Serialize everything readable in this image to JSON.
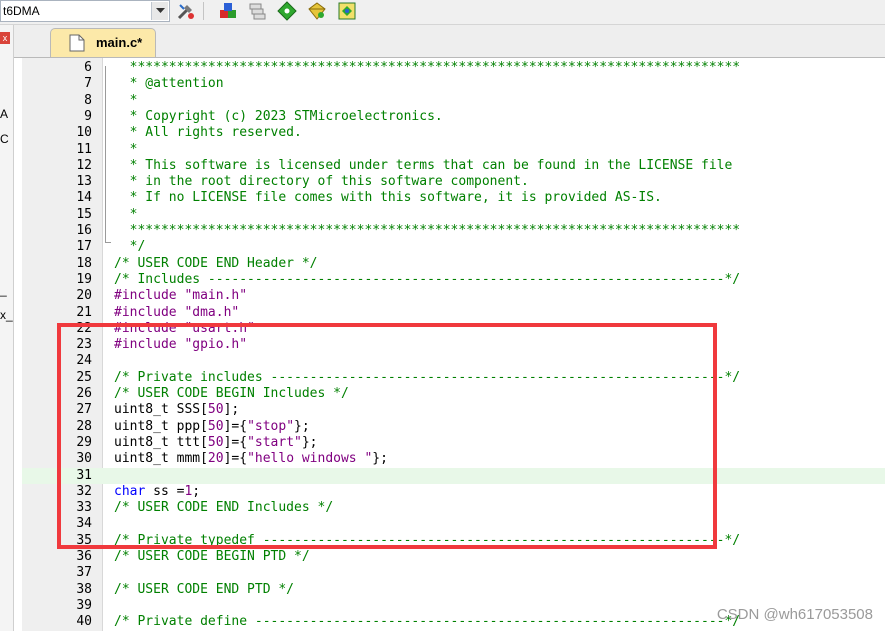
{
  "toolbar": {
    "target_name": "t6DMA",
    "icons": [
      "options-for-target-icon",
      "manage-components-icon",
      "file-extensions-icon",
      "select-packs-icon",
      "pack-installer-icon",
      "run-time-environment-icon"
    ]
  },
  "side_panel": {
    "close_glyph": "x",
    "fragments": [
      "A",
      "C",
      "_",
      "x_"
    ]
  },
  "tabs": [
    {
      "label": "main.c*",
      "active": true
    }
  ],
  "editor": {
    "lines": [
      {
        "n": "6",
        "t": [
          [
            "c-cmt",
            "  ******************************************************************************"
          ]
        ]
      },
      {
        "n": "7",
        "t": [
          [
            "c-cmt",
            "  * @attention"
          ]
        ]
      },
      {
        "n": "8",
        "t": [
          [
            "c-cmt",
            "  *"
          ]
        ]
      },
      {
        "n": "9",
        "t": [
          [
            "c-cmt",
            "  * Copyright (c) 2023 STMicroelectronics."
          ]
        ]
      },
      {
        "n": "10",
        "t": [
          [
            "c-cmt",
            "  * All rights reserved."
          ]
        ]
      },
      {
        "n": "11",
        "t": [
          [
            "c-cmt",
            "  *"
          ]
        ]
      },
      {
        "n": "12",
        "t": [
          [
            "c-cmt",
            "  * This software is licensed under terms that can be found in the LICENSE file"
          ]
        ]
      },
      {
        "n": "13",
        "t": [
          [
            "c-cmt",
            "  * in the root directory of this software component."
          ]
        ]
      },
      {
        "n": "14",
        "t": [
          [
            "c-cmt",
            "  * If no LICENSE file comes with this software, it is provided AS-IS."
          ]
        ]
      },
      {
        "n": "15",
        "t": [
          [
            "c-cmt",
            "  *"
          ]
        ]
      },
      {
        "n": "16",
        "t": [
          [
            "c-cmt",
            "  ******************************************************************************"
          ]
        ]
      },
      {
        "n": "17",
        "t": [
          [
            "c-cmt",
            "  */"
          ]
        ]
      },
      {
        "n": "18",
        "t": [
          [
            "c-cmt",
            "/* USER CODE END Header */"
          ]
        ]
      },
      {
        "n": "19",
        "t": [
          [
            "c-cmt",
            "/* Includes ------------------------------------------------------------------*/"
          ]
        ]
      },
      {
        "n": "20",
        "t": [
          [
            "c-pp",
            "#include "
          ],
          [
            "c-str",
            "\"main.h\""
          ]
        ]
      },
      {
        "n": "21",
        "t": [
          [
            "c-pp",
            "#include "
          ],
          [
            "c-str",
            "\"dma.h\""
          ]
        ]
      },
      {
        "n": "22",
        "t": [
          [
            "c-pp",
            "#include "
          ],
          [
            "c-str",
            "\"usart.h\""
          ]
        ]
      },
      {
        "n": "23",
        "t": [
          [
            "c-pp",
            "#include "
          ],
          [
            "c-str",
            "\"gpio.h\""
          ]
        ]
      },
      {
        "n": "24",
        "t": []
      },
      {
        "n": "25",
        "t": [
          [
            "c-cmt",
            "/* Private includes ----------------------------------------------------------*/"
          ]
        ]
      },
      {
        "n": "26",
        "t": [
          [
            "c-cmt",
            "/* USER CODE BEGIN Includes */"
          ]
        ]
      },
      {
        "n": "27",
        "t": [
          [
            "c-plain",
            "uint8_t SSS["
          ],
          [
            "c-num",
            "50"
          ],
          [
            "c-plain",
            "];"
          ]
        ]
      },
      {
        "n": "28",
        "t": [
          [
            "c-plain",
            "uint8_t ppp["
          ],
          [
            "c-num",
            "50"
          ],
          [
            "c-plain",
            "]={"
          ],
          [
            "c-str",
            "\"stop\""
          ],
          [
            "c-plain",
            "};"
          ]
        ]
      },
      {
        "n": "29",
        "t": [
          [
            "c-plain",
            "uint8_t ttt["
          ],
          [
            "c-num",
            "50"
          ],
          [
            "c-plain",
            "]={"
          ],
          [
            "c-str",
            "\"start\""
          ],
          [
            "c-plain",
            "};"
          ]
        ]
      },
      {
        "n": "30",
        "t": [
          [
            "c-plain",
            "uint8_t mmm["
          ],
          [
            "c-num",
            "20"
          ],
          [
            "c-plain",
            "]={"
          ],
          [
            "c-str",
            "\"hello windows \""
          ],
          [
            "c-plain",
            "};"
          ]
        ]
      },
      {
        "n": "31",
        "t": [],
        "highlight": true
      },
      {
        "n": "32",
        "t": [
          [
            "c-kw",
            "char"
          ],
          [
            "c-plain",
            " ss ="
          ],
          [
            "c-num",
            "1"
          ],
          [
            "c-plain",
            ";"
          ]
        ]
      },
      {
        "n": "33",
        "t": [
          [
            "c-cmt",
            "/* USER CODE END Includes */"
          ]
        ]
      },
      {
        "n": "34",
        "t": []
      },
      {
        "n": "35",
        "t": [
          [
            "c-cmt",
            "/* Private typedef -----------------------------------------------------------*/"
          ]
        ]
      },
      {
        "n": "36",
        "t": [
          [
            "c-cmt",
            "/* USER CODE BEGIN PTD */"
          ]
        ]
      },
      {
        "n": "37",
        "t": []
      },
      {
        "n": "38",
        "t": [
          [
            "c-cmt",
            "/* USER CODE END PTD */"
          ]
        ]
      },
      {
        "n": "39",
        "t": []
      },
      {
        "n": "40",
        "t": [
          [
            "c-cmt",
            "/* Private define ------------------------------------------------------------*/"
          ]
        ]
      }
    ]
  },
  "annotation": {
    "color": "#f0393d"
  },
  "watermark": "CSDN @wh617053508"
}
